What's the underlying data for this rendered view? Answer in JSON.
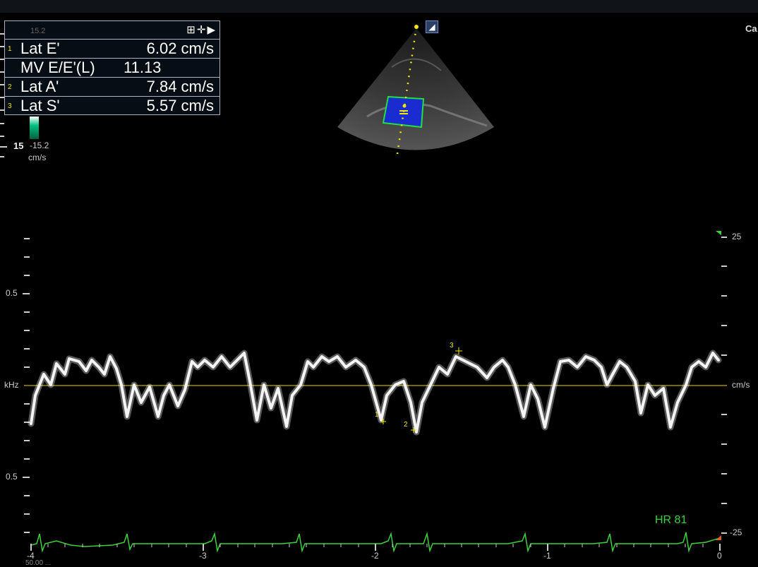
{
  "measurements": [
    {
      "index": "1",
      "label": "Lat E'",
      "value": "6.02 cm/s"
    },
    {
      "index": "",
      "label": "MV E/E'(L)",
      "value": "11.13"
    },
    {
      "index": "2",
      "label": "Lat A'",
      "value": "7.84 cm/s"
    },
    {
      "index": "3",
      "label": "Lat S'",
      "value": "5.57 cm/s"
    }
  ],
  "color_scale": {
    "top": "15.2",
    "bottom": "-15.2",
    "unit": "cm/s"
  },
  "depth_label": "15",
  "top_right_label": "Ca",
  "left_axis": {
    "labels": [
      "0.5",
      "kHz",
      "0.5"
    ]
  },
  "right_axis": {
    "labels": [
      "25",
      "cm/s",
      "-25"
    ]
  },
  "time_axis": {
    "labels": [
      "-4",
      "-3",
      "-2",
      "-1",
      "0"
    ]
  },
  "bottom_left_text": "50.00 ...",
  "heart_rate": "HR 81",
  "markers": [
    "1",
    "2",
    "3"
  ],
  "colors": {
    "ecg": "#3bd23b",
    "baseline": "#e8d800",
    "meas": "#f2e600",
    "doppler_box": "#1a2bd0"
  }
}
